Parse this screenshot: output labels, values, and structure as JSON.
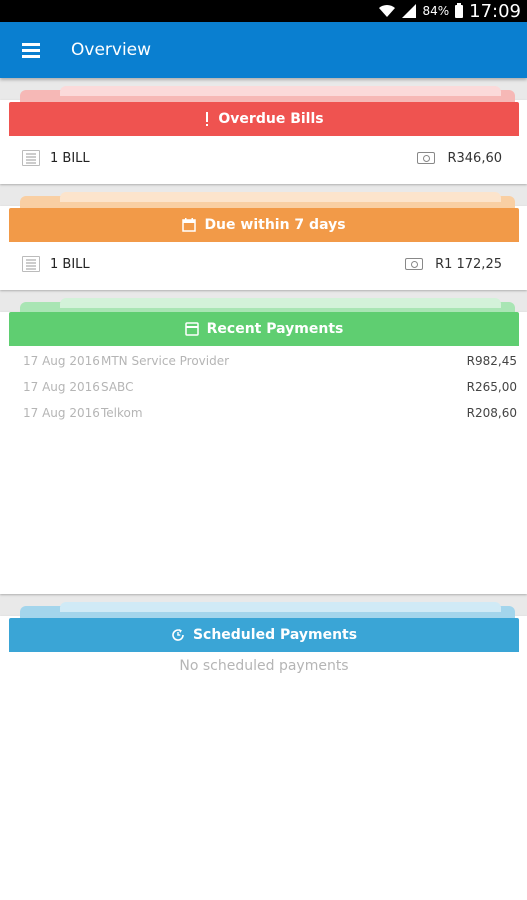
{
  "status_bar": {
    "battery": "84%",
    "time": "17:09"
  },
  "app_bar": {
    "title": "Overview"
  },
  "overdue": {
    "title": "Overdue Bills",
    "color": "#ef5350",
    "count_label": "1 BILL",
    "amount": "R346,60"
  },
  "due_soon": {
    "title": "Due within 7 days",
    "color": "#f29a48",
    "count_label": "1 BILL",
    "amount": "R1 172,25"
  },
  "recent": {
    "title": "Recent Payments",
    "color": "#5fce71",
    "rows": [
      {
        "date": "17 Aug 2016",
        "name": "MTN Service Provider",
        "amount": "R982,45"
      },
      {
        "date": "17 Aug 2016",
        "name": "SABC",
        "amount": "R265,00"
      },
      {
        "date": "17 Aug 2016",
        "name": "Telkom",
        "amount": "R208,60"
      }
    ]
  },
  "scheduled": {
    "title": "Scheduled Payments",
    "color": "#3aa5d6",
    "empty_text": "No scheduled payments"
  },
  "icons": {
    "menu": "hamburger-menu-icon",
    "overdue": "exclamation-icon",
    "due": "calendar-icon",
    "recent": "card-icon",
    "scheduled": "schedule-refresh-icon",
    "bill": "bill-icon",
    "money": "money-icon"
  }
}
